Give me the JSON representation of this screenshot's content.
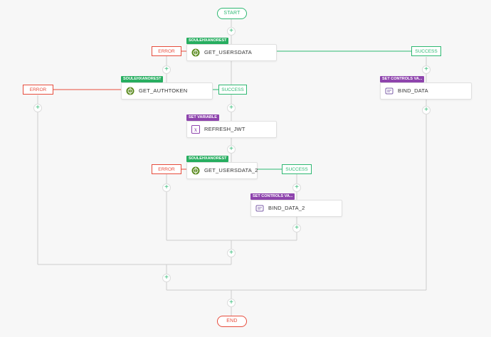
{
  "terminals": {
    "start": "START",
    "end": "END"
  },
  "branch_labels": {
    "error": "ERROR",
    "success": "SUCCESS"
  },
  "nodes": {
    "get_usersdata": {
      "badge": "SOULEHXANOREST",
      "label": "GET_USERSDATA",
      "icon": "rest-api-icon"
    },
    "get_authtoken": {
      "badge": "SOULEHXANOREST",
      "label": "GET_AUTHTOKEN",
      "icon": "rest-api-icon"
    },
    "bind_data": {
      "badge": "SET CONTROLS VA...",
      "label": "BIND_DATA",
      "icon": "set-controls-icon"
    },
    "refresh_jwt": {
      "badge": "SET VARIABLE",
      "label": "REFRESH_JWT",
      "icon": "variable-icon"
    },
    "get_usersdata_2": {
      "badge": "SOULEHXANOREST",
      "label": "GET_USERSDATA_2",
      "icon": "rest-api-icon"
    },
    "bind_data_2": {
      "badge": "SET CONTROLS VA...",
      "label": "BIND_DATA_2",
      "icon": "set-controls-icon"
    }
  },
  "add_step_glyph": "+",
  "colors": {
    "success": "#2eb872",
    "error": "#e74c3c",
    "rest_badge": "#27ae60",
    "set_badge": "#8e44ad",
    "wire": "#cccccc"
  }
}
